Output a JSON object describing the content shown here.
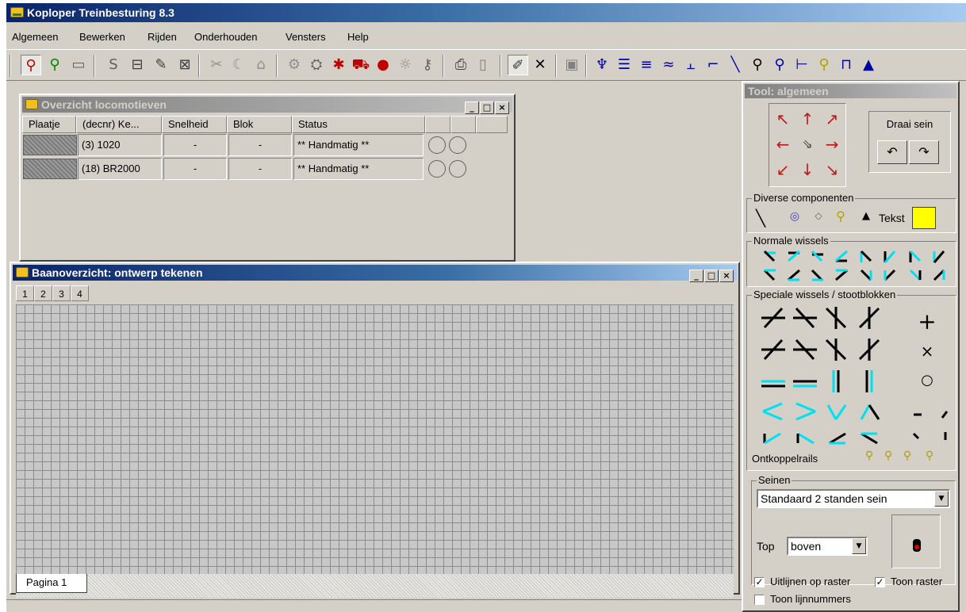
{
  "app": {
    "title": "Koploper Treinbesturing 8.3"
  },
  "menu": [
    "Algemeen",
    "Bewerken",
    "Rijden",
    "Onderhouden",
    "Vensters",
    "Help"
  ],
  "loco_window": {
    "title": "Overzicht locomotieven",
    "columns": [
      "Plaatje",
      "(decnr) Ke...",
      "Snelheid",
      "Blok",
      "Status"
    ],
    "rows": [
      {
        "name": "(3) 1020",
        "speed": "-",
        "block": "-",
        "status": "** Handmatig **"
      },
      {
        "name": "(18) BR2000",
        "speed": "-",
        "block": "-",
        "status": "** Handmatig **"
      }
    ]
  },
  "track_window": {
    "title": "Baanoverzicht: ontwerp tekenen",
    "page_tabs": [
      "1",
      "2",
      "3",
      "4"
    ],
    "sheet_tab": "Pagina 1"
  },
  "tool_panel": {
    "title": "Tool: algemeen",
    "rotate_label": "Draai sein",
    "misc_group": "Diverse componenten",
    "text_label": "Tekst",
    "text_color": "#ffff00",
    "normal_switches_group": "Normale wissels",
    "special_group": "Speciale wissels / stootblokken",
    "uncoupler_label": "Ontkoppelrails",
    "signals_group": "Seinen",
    "signal_type": "Standaard 2 standen sein",
    "top_label": "Top",
    "top_value": "boven",
    "align_grid": "Uitlijnen op raster",
    "show_grid": "Toon raster",
    "show_line_numbers": "Toon lijnnummers",
    "accent_cyan": "#00e0f0",
    "arrow_red": "#c01818"
  },
  "window_buttons": {
    "minimize": "_",
    "maximize": "□",
    "close": "×"
  },
  "icons": {
    "signal_red": "⚲",
    "signal_green": "⚲",
    "speedo": "▭",
    "s": "S",
    "block": "⊟",
    "edit": "✎",
    "x_box": "⊠",
    "scissors": "✂",
    "moon": "☾",
    "house": "⌂",
    "gear": "⚙",
    "plug": "⛭",
    "asterisk": "✱",
    "loco": "⛟",
    "dot": "●",
    "sun": "☼",
    "key": "⚷",
    "printer": "⎙",
    "page": "▯",
    "pencil": "✐",
    "delete": "✕",
    "save": "▣",
    "tree": "♆",
    "lines": "☰",
    "lines2": "≡",
    "track": "≈",
    "switch": "⫠",
    "corner": "⌐",
    "slash": "╲",
    "signal2": "⚲",
    "branch": "⊢",
    "pin": "⚲",
    "block2": "⊓",
    "triangle": "▲",
    "rotate_left": "↶",
    "rotate_right": "↷",
    "pointer": "⇘",
    "arrow_nw": "↖",
    "arrow_n": "↑",
    "arrow_ne": "↗",
    "arrow_w": "←",
    "arrow_e": "→",
    "arrow_sw": "↙",
    "arrow_s": "↓",
    "arrow_se": "↘",
    "misc_line": "╲",
    "misc_ring": "◎",
    "misc_diamond": "◇",
    "misc_pin": "⚲",
    "misc_triangle": "▲",
    "plus": "+",
    "cross": "×",
    "circle": "○",
    "check": "✓"
  }
}
